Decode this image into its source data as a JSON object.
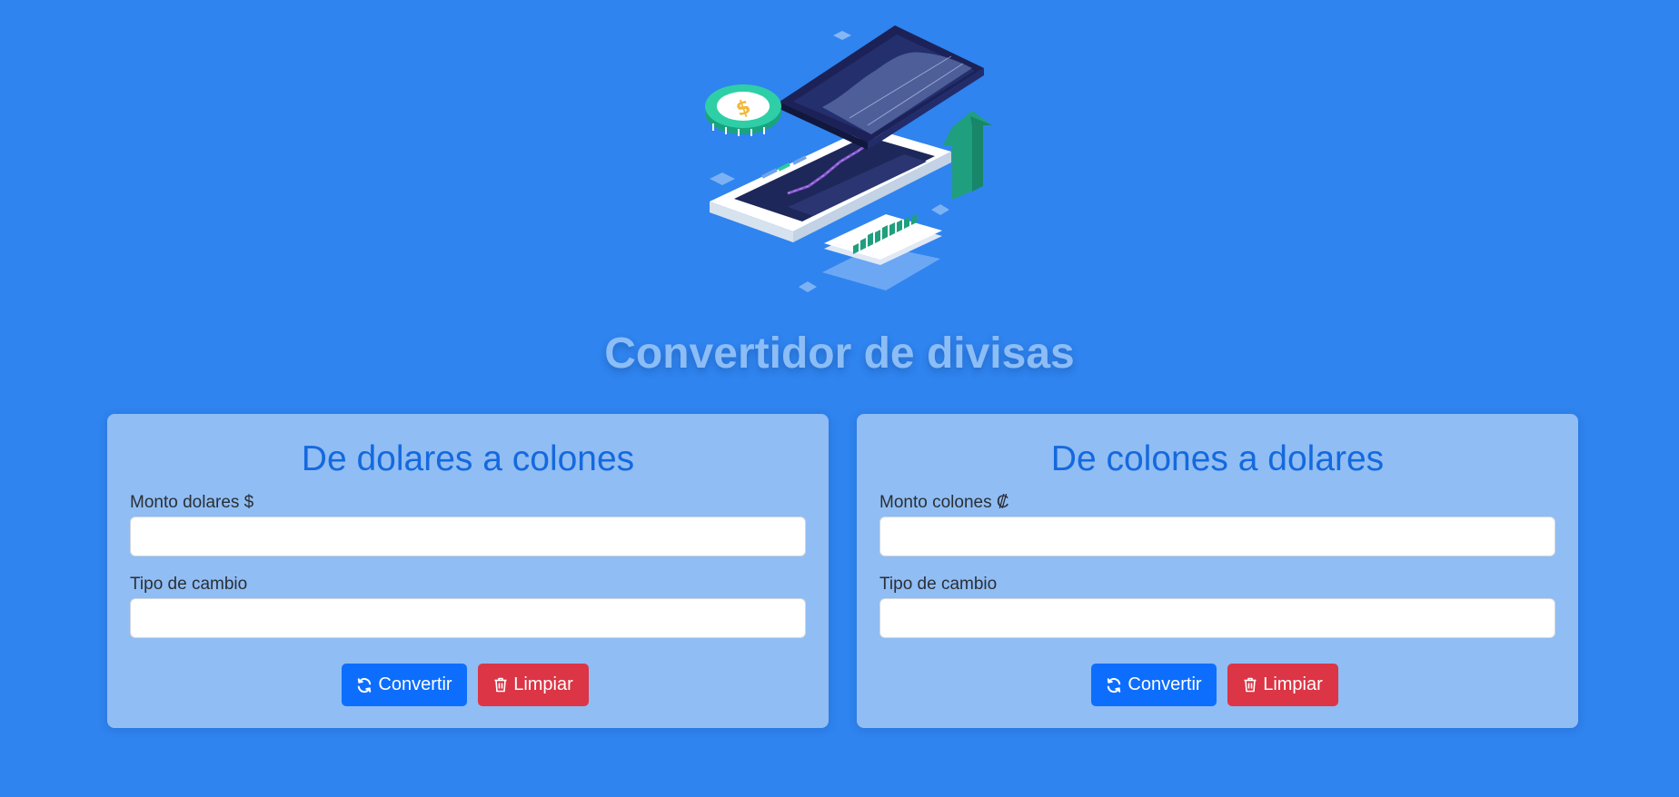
{
  "page": {
    "title": "Convertidor de divisas"
  },
  "cards": [
    {
      "heading": "De dolares a colones",
      "amount_label": "Monto dolares $",
      "amount_value": "",
      "rate_label": "Tipo de cambio",
      "rate_value": "",
      "convert_label": "Convertir",
      "clear_label": "Limpiar"
    },
    {
      "heading": "De colones a dolares",
      "amount_label": "Monto colones ₡",
      "amount_value": "",
      "rate_label": "Tipo de cambio",
      "rate_value": "",
      "convert_label": "Convertir",
      "clear_label": "Limpiar"
    }
  ],
  "icons": {
    "hero": "finance-phone-illustration",
    "convert": "refresh-icon",
    "clear": "trash-icon"
  },
  "colors": {
    "background": "#2f84ef",
    "title": "#8cbdf6",
    "card": "#90bdf3",
    "heading": "#1469df",
    "primary": "#0d6efd",
    "danger": "#dc3545"
  }
}
